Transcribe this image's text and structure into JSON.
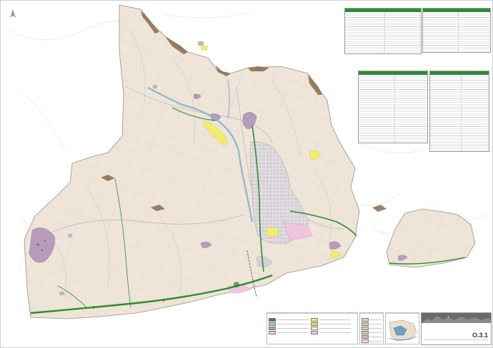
{
  "map": {
    "sheet_number": "O.3.1",
    "colors": {
      "land": "#eee4d8",
      "parcels": "#d9cfc3",
      "urban": "#c9c4cc",
      "green_system": "#2e8b2e",
      "river": "#8fb5cf",
      "protected_purple": "#b79bbd",
      "yellow_equipment": "#f2ec6e",
      "pink_zone": "#f1c4de",
      "sea": "#ffffff",
      "table_header": "#2f8a3a",
      "relief_brown": "#7a5a3a"
    },
    "icons": [
      "north-arrow-icon",
      "municipal-logo-icon"
    ]
  }
}
